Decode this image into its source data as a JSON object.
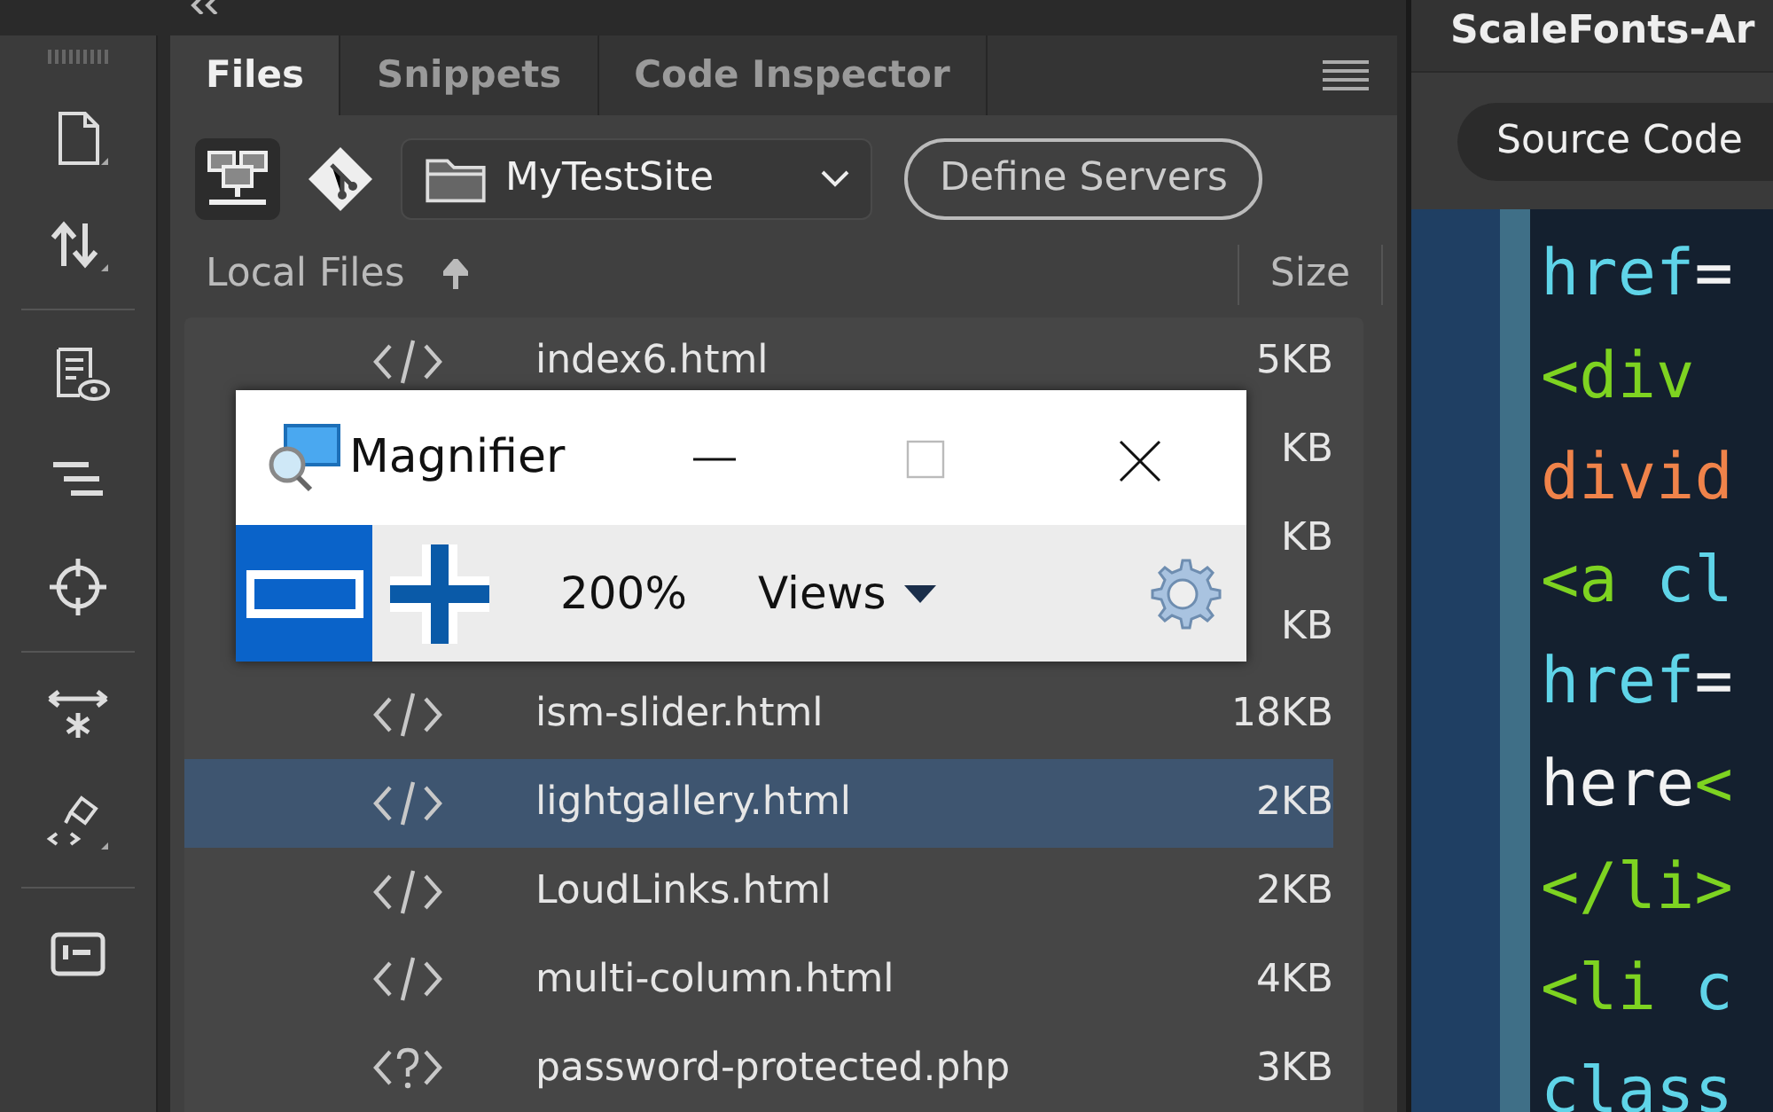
{
  "tabs": [
    {
      "label": "Files",
      "selected": true
    },
    {
      "label": "Snippets",
      "selected": false
    },
    {
      "label": "Code Inspector",
      "selected": false
    }
  ],
  "site_select": {
    "value": "MyTestSite"
  },
  "define_servers": "Define Servers",
  "columns": {
    "name": "Local Files",
    "size": "Size"
  },
  "rows": [
    {
      "kind": "html",
      "name": "index6.html",
      "size": "5KB",
      "selected": false
    },
    {
      "kind": "hidden",
      "size": "KB",
      "selected": false
    },
    {
      "kind": "hidden",
      "size": "KB",
      "selected": false
    },
    {
      "kind": "hidden",
      "size": "KB",
      "selected": false
    },
    {
      "kind": "html",
      "name": "ism-slider.html",
      "size": "18KB",
      "selected": false
    },
    {
      "kind": "html",
      "name": "lightgallery.html",
      "size": "2KB",
      "selected": true
    },
    {
      "kind": "html",
      "name": "LoudLinks.html",
      "size": "2KB",
      "selected": false
    },
    {
      "kind": "html",
      "name": "multi-column.html",
      "size": "4KB",
      "selected": false
    },
    {
      "kind": "php",
      "name": "password-protected.php",
      "size": "3KB",
      "selected": false
    }
  ],
  "magnifier": {
    "title": "Magnifier",
    "zoom": "200%",
    "views": "Views"
  },
  "editor": {
    "title": "ScaleFonts-Ar",
    "view_button": "Source Code",
    "lines": [
      [
        {
          "text": "href",
          "kind": "attr"
        },
        {
          "text": "=",
          "kind": "plain"
        }
      ],
      [
        {
          "text": "<div",
          "kind": "tag"
        }
      ],
      [
        {
          "text": "divid",
          "kind": "value"
        }
      ],
      [
        {
          "text": "<a",
          "kind": "tag"
        },
        {
          "text": " cl",
          "kind": "attr"
        }
      ],
      [
        {
          "text": "href",
          "kind": "attr"
        },
        {
          "text": "=",
          "kind": "plain"
        }
      ],
      [
        {
          "text": "here",
          "kind": "plain"
        },
        {
          "text": "<",
          "kind": "tag"
        }
      ],
      [
        {
          "text": "</li>",
          "kind": "tag"
        }
      ],
      [
        {
          "text": "<li",
          "kind": "tag"
        },
        {
          "text": " c",
          "kind": "attr"
        }
      ],
      [
        {
          "text": "class",
          "kind": "attr"
        }
      ]
    ]
  }
}
